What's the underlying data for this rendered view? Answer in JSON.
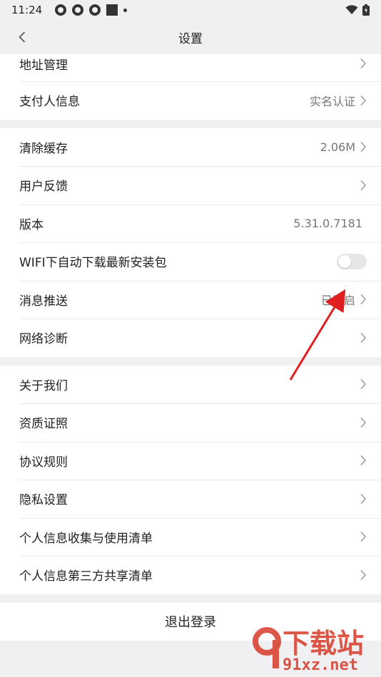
{
  "status_bar": {
    "time": "11:24"
  },
  "header": {
    "title": "设置"
  },
  "group1": [
    {
      "label": "地址管理",
      "value": ""
    },
    {
      "label": "支付人信息",
      "value": "实名认证"
    }
  ],
  "group2": {
    "cache": {
      "label": "清除缓存",
      "value": "2.06M"
    },
    "feedback": {
      "label": "用户反馈"
    },
    "version": {
      "label": "版本",
      "value": "5.31.0.7181"
    },
    "wifi_download": {
      "label": "WIFI下自动下载最新安装包",
      "enabled": false
    },
    "push": {
      "label": "消息推送",
      "value": "已开启"
    },
    "network": {
      "label": "网络诊断"
    }
  },
  "group3": [
    {
      "label": "关于我们"
    },
    {
      "label": "资质证照"
    },
    {
      "label": "协议规则"
    },
    {
      "label": "隐私设置"
    },
    {
      "label": "个人信息收集与使用清单"
    },
    {
      "label": "个人信息第三方共享清单"
    }
  ],
  "logout": {
    "label": "退出登录"
  },
  "watermark": {
    "brand": "下载站",
    "site": "91xz.net"
  },
  "colors": {
    "arrow": "#e02020",
    "watermark": "#d83a2a"
  }
}
